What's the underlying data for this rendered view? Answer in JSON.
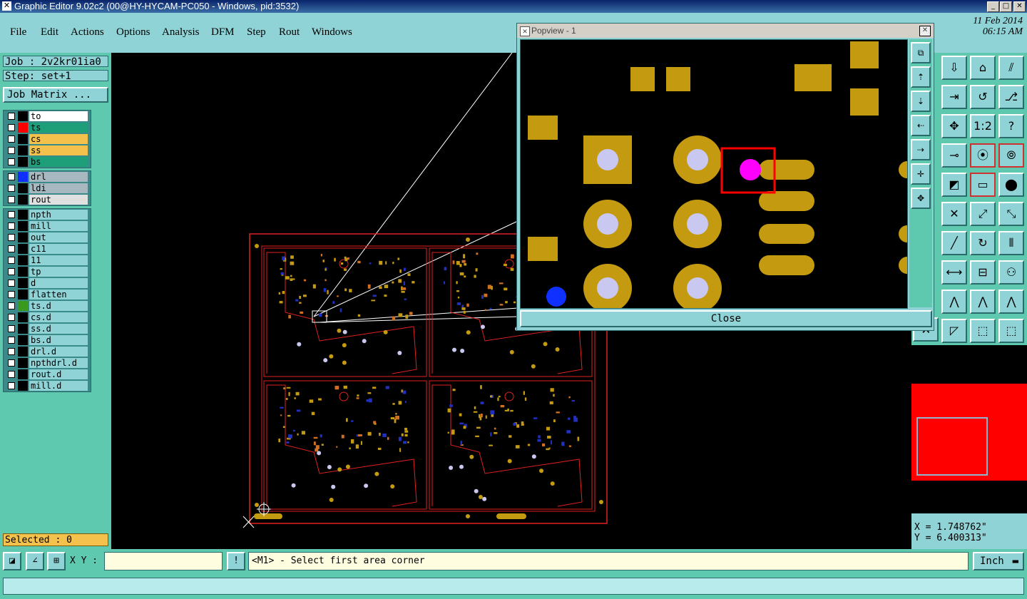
{
  "window": {
    "title": "Graphic Editor 9.02c2 (00@HY-HYCAM-PC050 - Windows, pid:3532)"
  },
  "menu": [
    "File",
    "Edit",
    "Actions",
    "Options",
    "Analysis",
    "DFM",
    "Step",
    "Rout",
    "Windows"
  ],
  "date": {
    "line1": "11 Feb 2014",
    "line2": "06:15 AM"
  },
  "left": {
    "job": "Job : 2v2kr01ia0",
    "step": "Step: set+1",
    "job_matrix": "Job Matrix ..."
  },
  "layers": {
    "board": [
      {
        "name": "to",
        "color": "#ffffff",
        "swatch": "#000000"
      },
      {
        "name": "ts",
        "color": "#1f9e7a",
        "swatch": "#ff0000"
      },
      {
        "name": "cs",
        "color": "#f3c14c",
        "swatch": "#000000"
      },
      {
        "name": "ss",
        "color": "#f3c14c",
        "swatch": "#000000"
      },
      {
        "name": "bs",
        "color": "#1f9e7a",
        "swatch": "#000000"
      }
    ],
    "drill": [
      {
        "name": "drl",
        "color": "#a8b8c0",
        "swatch": "#1030ff"
      },
      {
        "name": "ldi",
        "color": "#a8b8c0",
        "swatch": "#000000"
      },
      {
        "name": "rout",
        "color": "#e0e0e0",
        "swatch": "#000000"
      }
    ],
    "misc": [
      {
        "name": "npth",
        "color": "#8fd3d6",
        "swatch": "#000000"
      },
      {
        "name": "mill",
        "color": "#8fd3d6",
        "swatch": "#000000"
      },
      {
        "name": "out",
        "color": "#8fd3d6",
        "swatch": "#000000"
      },
      {
        "name": "c11",
        "color": "#8fd3d6",
        "swatch": "#000000"
      },
      {
        "name": "11",
        "color": "#8fd3d6",
        "swatch": "#000000"
      },
      {
        "name": "tp",
        "color": "#8fd3d6",
        "swatch": "#000000"
      },
      {
        "name": "d",
        "color": "#8fd3d6",
        "swatch": "#000000"
      },
      {
        "name": "flatten",
        "color": "#8fd3d6",
        "swatch": "#000000"
      },
      {
        "name": "ts.d",
        "color": "#8fd3d6",
        "swatch": "#3a9a20"
      },
      {
        "name": "cs.d",
        "color": "#8fd3d6",
        "swatch": "#000000"
      },
      {
        "name": "ss.d",
        "color": "#8fd3d6",
        "swatch": "#000000"
      },
      {
        "name": "bs.d",
        "color": "#8fd3d6",
        "swatch": "#000000"
      },
      {
        "name": "drl.d",
        "color": "#8fd3d6",
        "swatch": "#000000"
      },
      {
        "name": "npthdrl.d",
        "color": "#8fd3d6",
        "swatch": "#000000"
      },
      {
        "name": "rout.d",
        "color": "#8fd3d6",
        "swatch": "#000000"
      },
      {
        "name": "mill.d",
        "color": "#8fd3d6",
        "swatch": "#000000"
      }
    ]
  },
  "selected": "Selected : 0",
  "popview": {
    "title": "Popview - 1",
    "close": "Close"
  },
  "coords": {
    "x": "X = 1.748762\"",
    "y": "Y = 6.400313\""
  },
  "bottom": {
    "xy_label": "X Y :",
    "xy_value": "",
    "prompt": "<M1> - Select first area corner",
    "unit": "Inch"
  },
  "colors": {
    "pad": "#c49a10",
    "drill": "#c8c8f0",
    "outline": "#e02020",
    "selection": "#ff00ff"
  }
}
